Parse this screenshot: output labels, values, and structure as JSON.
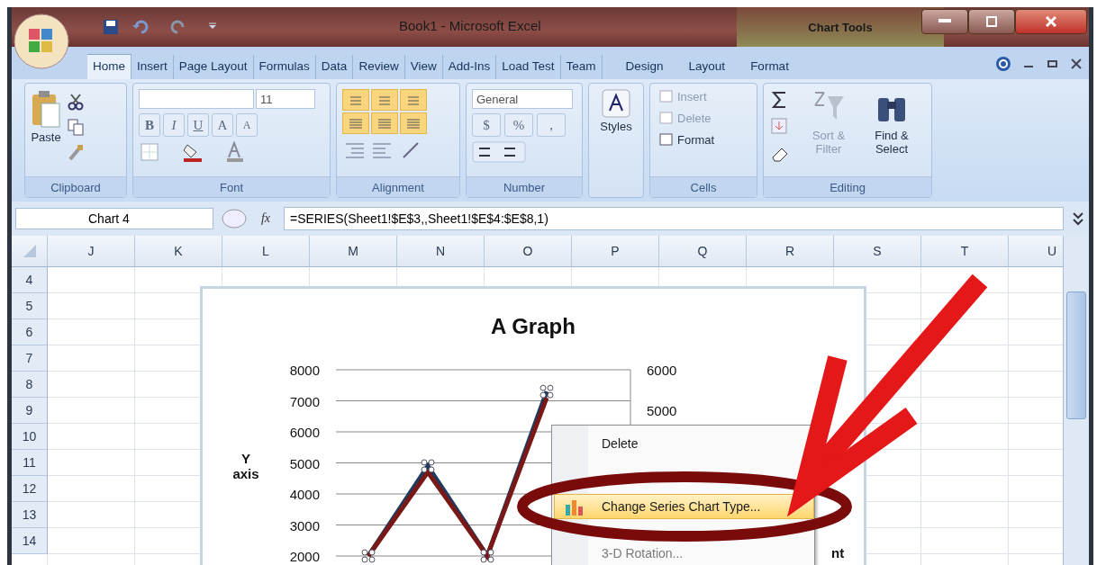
{
  "window": {
    "title": "Book1 - Microsoft Excel",
    "context_title": "Chart Tools"
  },
  "tabs": [
    {
      "label": "Home",
      "selected": true
    },
    {
      "label": "Insert",
      "selected": false
    },
    {
      "label": "Page Layout",
      "selected": false
    },
    {
      "label": "Formulas",
      "selected": false
    },
    {
      "label": "Data",
      "selected": false
    },
    {
      "label": "Review",
      "selected": false
    },
    {
      "label": "View",
      "selected": false
    },
    {
      "label": "Add-Ins",
      "selected": false
    },
    {
      "label": "Load Test",
      "selected": false
    },
    {
      "label": "Team",
      "selected": false
    }
  ],
  "context_tabs": [
    {
      "label": "Design",
      "selected": false
    },
    {
      "label": "Layout",
      "selected": false
    },
    {
      "label": "Format",
      "selected": false
    }
  ],
  "ribbon": [
    {
      "kind": "clipboard",
      "label": "Clipboard",
      "paste": "Paste"
    },
    {
      "kind": "font",
      "label": "Font",
      "font_size": "11",
      "buttons": [
        "B",
        "I",
        "U",
        "A",
        "A"
      ]
    },
    {
      "kind": "alignment",
      "label": "Alignment"
    },
    {
      "kind": "number",
      "label": "Number",
      "format": "General",
      "buttons": [
        "$",
        "%",
        ","
      ]
    },
    {
      "kind": "styles",
      "label": "Styles"
    },
    {
      "kind": "cells",
      "label": "Cells",
      "commands": [
        {
          "label": "Insert",
          "disabled": true
        },
        {
          "label": "Delete",
          "disabled": true
        },
        {
          "label": "Format",
          "disabled": false
        }
      ]
    },
    {
      "kind": "editing",
      "label": "Editing",
      "commands": [
        {
          "label": "Sort & Filter",
          "disabled": true
        },
        {
          "label": "Find & Select",
          "disabled": false
        }
      ]
    }
  ],
  "formula_bar": {
    "name_box": "Chart 4",
    "fx": "fx",
    "formula": "=SERIES(Sheet1!$E$3,,Sheet1!$E$4:$E$8,1)"
  },
  "sheet": {
    "columns": [
      "J",
      "K",
      "L",
      "M",
      "N",
      "O",
      "P",
      "Q",
      "R",
      "S",
      "T",
      "U"
    ],
    "rows": [
      "4",
      "5",
      "6",
      "7",
      "8",
      "9",
      "10",
      "11",
      "12",
      "13",
      "14"
    ]
  },
  "chart": {
    "secondary_ticks": [
      "6000",
      "5000"
    ],
    "legend_fragment": "nt",
    "chart_data": {
      "type": "line",
      "title": "A Graph",
      "ylabel": "Y axis",
      "grid": true,
      "ylim": [
        2000,
        8000
      ],
      "yticks": [
        2000,
        3000,
        4000,
        5000,
        6000,
        7000,
        8000
      ],
      "series": [
        {
          "color": "#1f3a5f",
          "values": [
            2000,
            4900,
            2000,
            7300
          ]
        },
        {
          "color": "#7a1818",
          "values": [
            2000,
            4700,
            2000,
            7100
          ]
        }
      ]
    }
  },
  "context_menu": [
    {
      "label": "Delete",
      "selected": false,
      "disabled": false
    },
    {
      "label": "Change Series Chart Type...",
      "selected": true,
      "disabled": false
    },
    {
      "label": "3-D Rotation...",
      "selected": false,
      "disabled": true
    }
  ]
}
